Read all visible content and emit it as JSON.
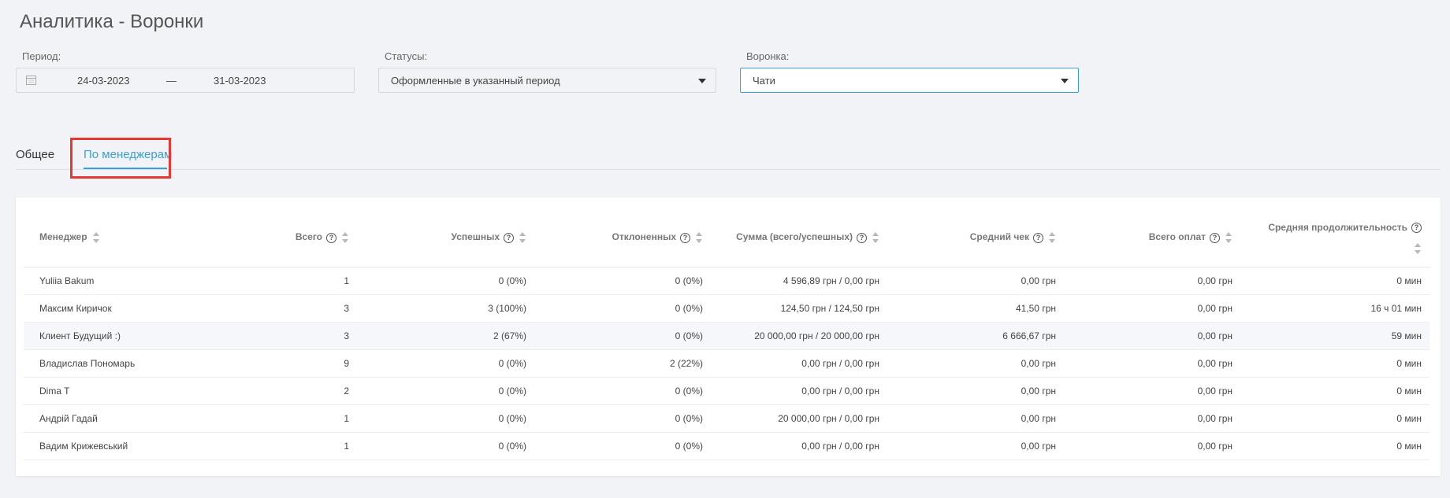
{
  "page": {
    "title": "Аналитика - Воронки"
  },
  "filters": {
    "period_label": "Период:",
    "date_from": "24-03-2023",
    "date_separator": "—",
    "date_to": "31-03-2023",
    "statuses_label": "Статусы:",
    "statuses_value": "Оформленные в указанный период",
    "funnel_label": "Воронка:",
    "funnel_value": "Чати"
  },
  "tabs": [
    {
      "label": "Общее",
      "active": false
    },
    {
      "label": "По менеджерам",
      "active": true
    }
  ],
  "table": {
    "columns": [
      {
        "label": "Менеджер",
        "help": false
      },
      {
        "label": "Всего",
        "help": true
      },
      {
        "label": "Успешных",
        "help": true
      },
      {
        "label": "Отклоненных",
        "help": true
      },
      {
        "label": "Сумма (всего/успешных)",
        "help": true
      },
      {
        "label": "Средний чек",
        "help": true
      },
      {
        "label": "Всего оплат",
        "help": true
      },
      {
        "label": "Средняя продолжительность",
        "help": true
      }
    ],
    "rows": [
      [
        "Yuliia Bakum",
        "1",
        "0 (0%)",
        "0 (0%)",
        "4 596,89 грн / 0,00 грн",
        "0,00 грн",
        "0,00 грн",
        "0 мин"
      ],
      [
        "Максим Киричок",
        "3",
        "3 (100%)",
        "0 (0%)",
        "124,50 грн / 124,50 грн",
        "41,50 грн",
        "0,00 грн",
        "16 ч 01 мин"
      ],
      [
        "Клиент Будущий :)",
        "3",
        "2 (67%)",
        "0 (0%)",
        "20 000,00 грн / 20 000,00 грн",
        "6 666,67 грн",
        "0,00 грн",
        "59 мин"
      ],
      [
        "Владислав Пономарь",
        "9",
        "0 (0%)",
        "2 (22%)",
        "0,00 грн / 0,00 грн",
        "0,00 грн",
        "0,00 грн",
        "0 мин"
      ],
      [
        "Dima T",
        "2",
        "0 (0%)",
        "0 (0%)",
        "0,00 грн / 0,00 грн",
        "0,00 грн",
        "0,00 грн",
        "0 мин"
      ],
      [
        "Андрій Гадай",
        "1",
        "0 (0%)",
        "0 (0%)",
        "20 000,00 грн / 0,00 грн",
        "0,00 грн",
        "0,00 грн",
        "0 мин"
      ],
      [
        "Вадим Крижевський",
        "1",
        "0 (0%)",
        "0 (0%)",
        "0,00 грн / 0,00 грн",
        "0,00 грн",
        "0,00 грн",
        "0 мин"
      ]
    ]
  },
  "colors": {
    "accent": "#3aa0d8",
    "highlight": "#e53935"
  }
}
